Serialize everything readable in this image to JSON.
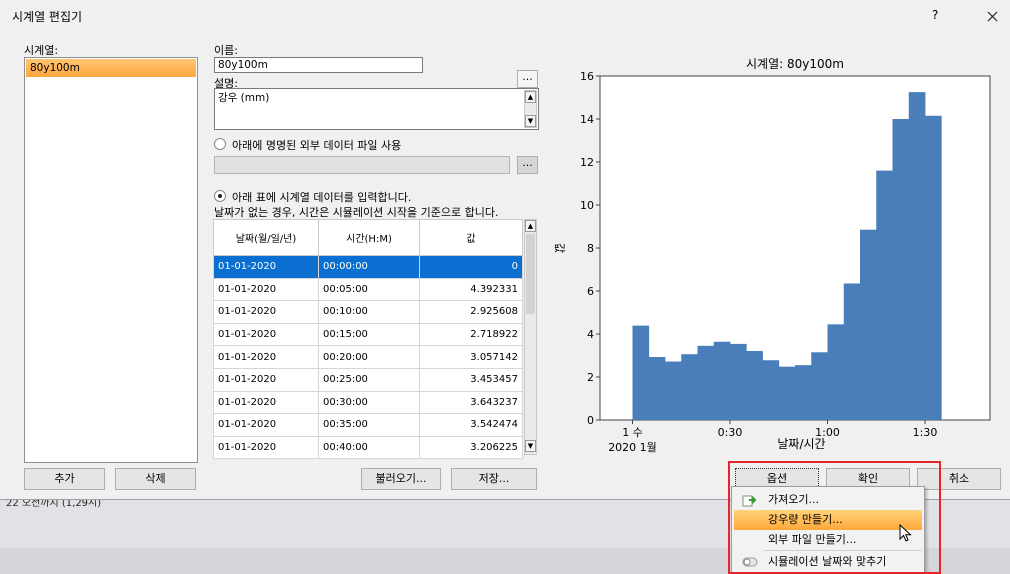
{
  "window": {
    "title": "시계열 편집기",
    "help": "?",
    "close": "✕"
  },
  "left": {
    "label": "시계열:",
    "items": [
      "80y100m"
    ],
    "add": "추가",
    "delete": "삭제"
  },
  "form": {
    "name_label": "이름:",
    "name_value": "80y100m",
    "desc_label": "설명:",
    "desc_value": "강우 (mm)",
    "browse": "...",
    "radio_external": "아래에 명명된 외부 데이터 파일 사용",
    "external_path": "",
    "radio_table": "아래 표에 시계열 데이터를 입력합니다.",
    "note": "날짜가 없는 경우, 시간은 시뮬레이션 시작을 기준으로 합니다.",
    "load": "불러오기...",
    "save": "저장..."
  },
  "table": {
    "headers": [
      "날짜(월/일/년)",
      "시간(H:M)",
      "값"
    ],
    "rows": [
      [
        "01-01-2020",
        "00:00:00",
        "0"
      ],
      [
        "01-01-2020",
        "00:05:00",
        "4.392331"
      ],
      [
        "01-01-2020",
        "00:10:00",
        "2.925608"
      ],
      [
        "01-01-2020",
        "00:15:00",
        "2.718922"
      ],
      [
        "01-01-2020",
        "00:20:00",
        "3.057142"
      ],
      [
        "01-01-2020",
        "00:25:00",
        "3.453457"
      ],
      [
        "01-01-2020",
        "00:30:00",
        "3.643237"
      ],
      [
        "01-01-2020",
        "00:35:00",
        "3.542474"
      ],
      [
        "01-01-2020",
        "00:40:00",
        "3.206225"
      ]
    ]
  },
  "buttons": {
    "options": "옵션",
    "ok": "확인",
    "cancel": "취소"
  },
  "menu": {
    "items": [
      "가져오기...",
      "강우량 만들기...",
      "외부 파일 만들기...",
      "시뮬레이션 날짜와 맞추기"
    ]
  },
  "background": {
    "text": "22 오전까지 (1,29시)"
  },
  "colors": {
    "bar": "#4a7ebb",
    "selection": "#0a6fd0",
    "highlight": "#ffa83a",
    "redbox": "#e3262b"
  },
  "chart_data": {
    "type": "bar",
    "title": "시계열: 80y100m",
    "ylabel": "값",
    "xlabel": "날짜/시간",
    "x_ticks": [
      "1 수",
      "0:30",
      "1:00",
      "1:30"
    ],
    "x_subticks": [
      "2020 1월"
    ],
    "y_ticks": [
      "0",
      "2",
      "4",
      "6",
      "8",
      "10",
      "12",
      "14",
      "16"
    ],
    "ylim": [
      0,
      16
    ],
    "x_minutes_range": [
      -10,
      110
    ],
    "interval_minutes": 5,
    "values": [
      4.39,
      2.93,
      2.72,
      3.06,
      3.45,
      3.64,
      3.54,
      3.21,
      2.78,
      2.48,
      2.55,
      3.15,
      4.45,
      6.35,
      8.85,
      11.6,
      14.0,
      15.25,
      14.15
    ]
  }
}
